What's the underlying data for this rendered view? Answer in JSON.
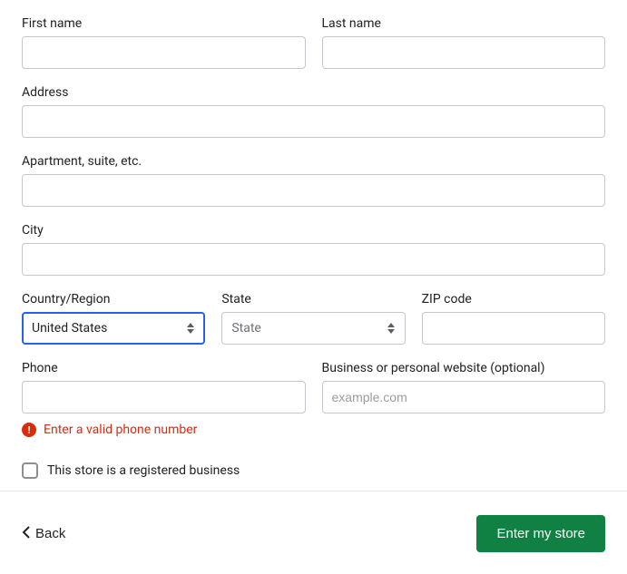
{
  "fields": {
    "first_name": {
      "label": "First name",
      "value": ""
    },
    "last_name": {
      "label": "Last name",
      "value": ""
    },
    "address": {
      "label": "Address",
      "value": ""
    },
    "apartment": {
      "label": "Apartment, suite, etc.",
      "value": ""
    },
    "city": {
      "label": "City",
      "value": ""
    },
    "country": {
      "label": "Country/Region",
      "value": "United States"
    },
    "state": {
      "label": "State",
      "value": "State"
    },
    "zip": {
      "label": "ZIP code",
      "value": ""
    },
    "phone": {
      "label": "Phone",
      "value": "",
      "error": "Enter a valid phone number"
    },
    "website": {
      "label": "Business or personal website (optional)",
      "placeholder": "example.com",
      "value": ""
    }
  },
  "checkbox": {
    "label": "This store is a registered business",
    "checked": false
  },
  "footer": {
    "back": "Back",
    "submit": "Enter my store"
  }
}
